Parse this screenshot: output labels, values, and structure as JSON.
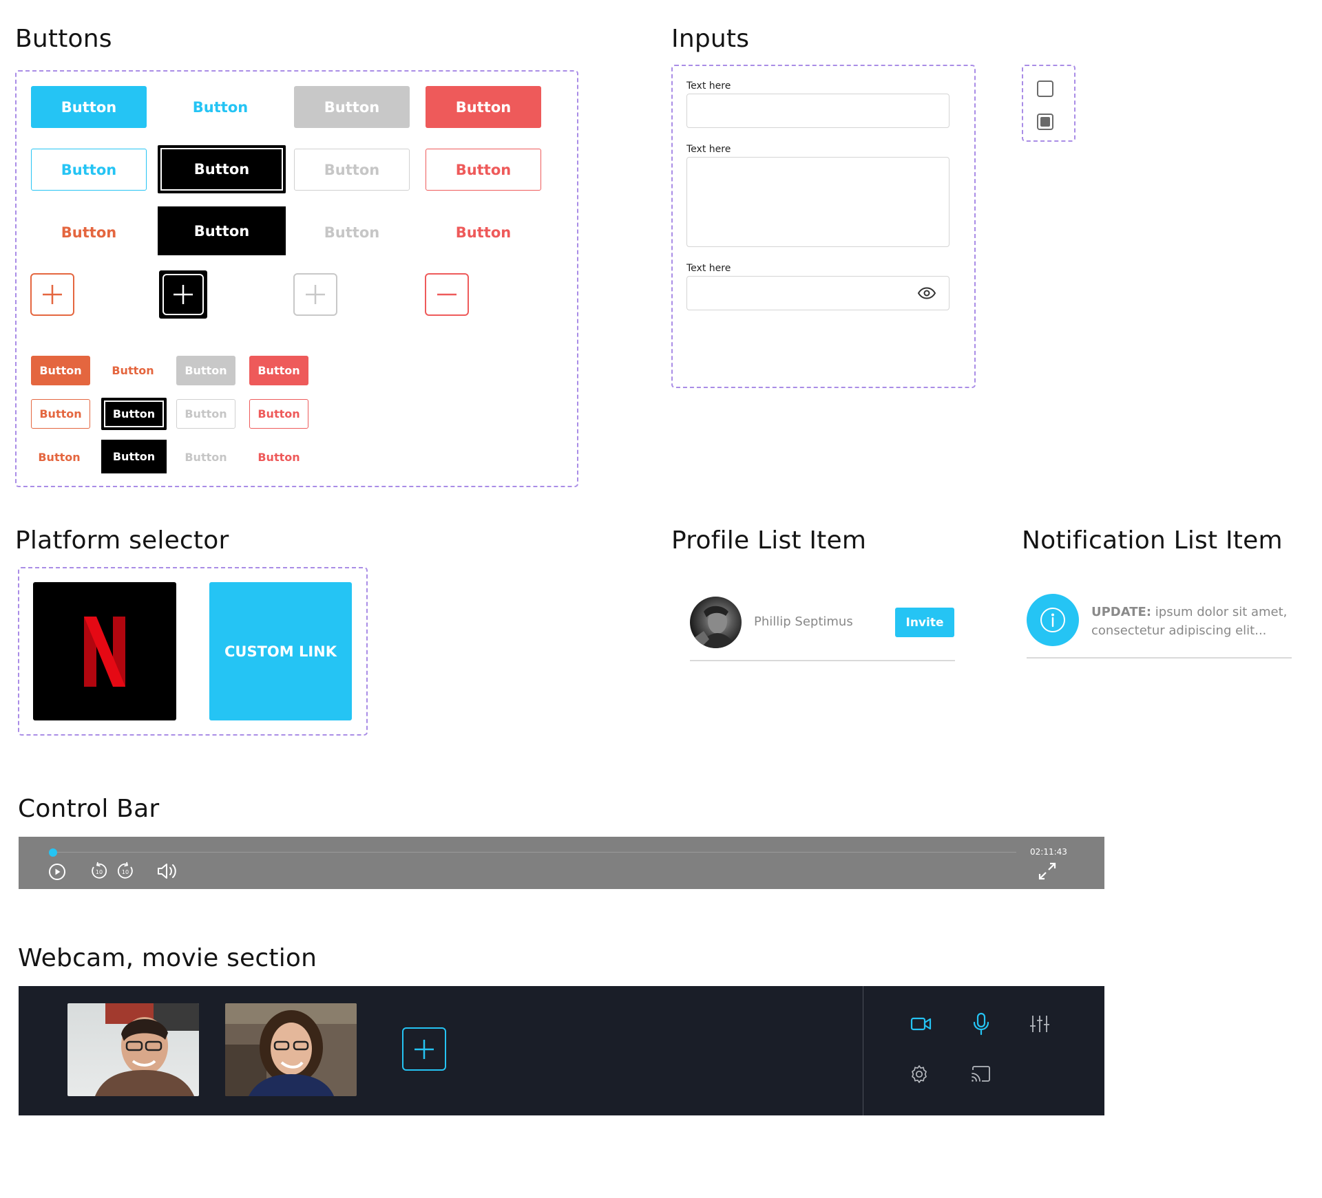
{
  "sections": {
    "buttons": "Buttons",
    "inputs": "Inputs",
    "platform": "Platform selector",
    "profile": "Profile List Item",
    "notification": "Notification List Item",
    "control_bar": "Control Bar",
    "webcam": "Webcam, movie section"
  },
  "buttons": {
    "label": "Button"
  },
  "inputs": {
    "field1_label": "Text here",
    "field2_label": "Text here",
    "field3_label": "Text here"
  },
  "platform": {
    "custom_link": "CUSTOM LINK",
    "netflix_letter": "N"
  },
  "profile": {
    "name": "Phillip Septimus",
    "invite": "Invite"
  },
  "notification": {
    "prefix": "UPDATE:",
    "text_line1": " ipsum dolor sit amet,",
    "text_line2": "consectetur adipiscing elit..."
  },
  "control_bar": {
    "time": "02:11:43",
    "progress": 0.0,
    "skip_seconds": "10"
  },
  "colors": {
    "accent": "#25c4f4",
    "red": "#ee5a5a",
    "orange": "#e4663f",
    "gray": "#c8c8c8",
    "dashed_border": "#a98ce6",
    "webcam_bg": "#1a1e28",
    "control_bar_bg": "#808080"
  },
  "icons": {
    "play": "play-icon",
    "rewind": "rewind-10-icon",
    "forward": "forward-10-icon",
    "volume": "volume-icon",
    "fullscreen": "fullscreen-icon",
    "camera": "video-camera-icon",
    "mic": "microphone-icon",
    "settings_sliders": "sliders-icon",
    "gear": "gear-icon",
    "cast": "cast-icon",
    "plus": "plus-icon",
    "minus": "minus-icon",
    "eye": "eye-icon",
    "info": "info-icon"
  }
}
